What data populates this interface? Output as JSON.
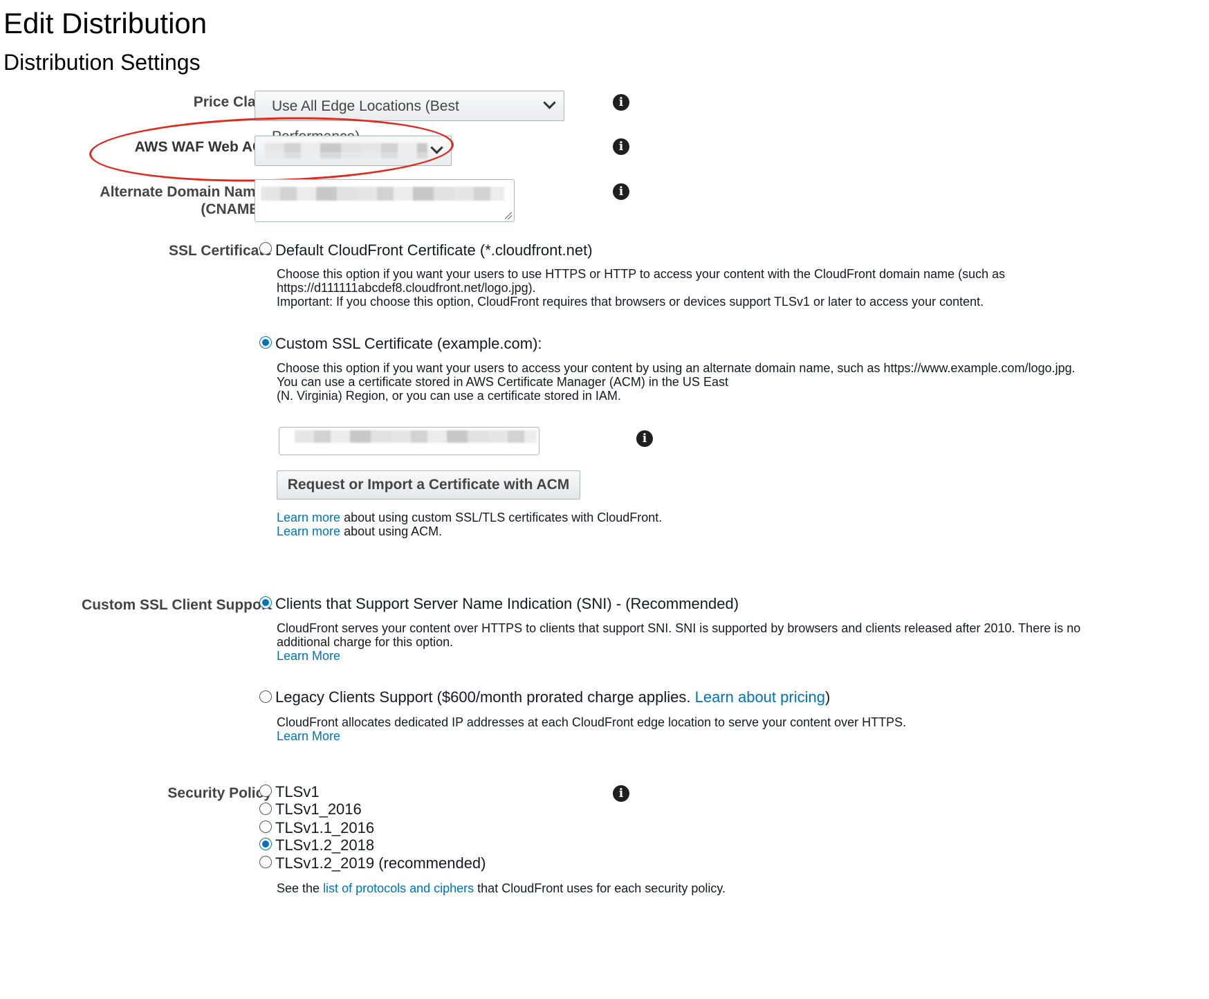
{
  "page": {
    "title": "Edit Distribution",
    "section": "Distribution Settings"
  },
  "price_class": {
    "label": "Price Class",
    "value": "Use All Edge Locations (Best Performance)"
  },
  "waf": {
    "label": "AWS WAF Web ACL"
  },
  "cnames": {
    "label_line1": "Alternate Domain Names",
    "label_line2": "(CNAMEs)"
  },
  "ssl": {
    "label": "SSL Certificate",
    "default_option": "Default CloudFront Certificate (*.cloudfront.net)",
    "default_desc_1": "Choose this option if you want your users to use HTTPS or HTTP to access your content with the CloudFront domain name (such as",
    "default_desc_2": "https://d111111abcdef8.cloudfront.net/logo.jpg).",
    "default_desc_3": "Important: If you choose this option, CloudFront requires that browsers or devices support TLSv1 or later to access your content.",
    "custom_option": "Custom SSL Certificate (example.com):",
    "custom_desc_1": "Choose this option if you want your users to access your content by using an alternate domain name, such as https://www.example.com/logo.jpg.",
    "custom_desc_2": "You can use a certificate stored in AWS Certificate Manager (ACM) in the US East",
    "custom_desc_3": "(N. Virginia) Region, or you can use a certificate stored in IAM.",
    "acm_button": "Request or Import a Certificate with ACM",
    "learn_more_1_link": "Learn more",
    "learn_more_1_text": " about using custom SSL/TLS certificates with CloudFront.",
    "learn_more_2_link": "Learn more",
    "learn_more_2_text": " about using ACM."
  },
  "client_support": {
    "label": "Custom SSL Client Support",
    "sni_option": "Clients that Support Server Name Indication (SNI) - (Recommended)",
    "sni_desc_1": "CloudFront serves your content over HTTPS to clients that support SNI. SNI is supported by browsers and clients released after 2010. There is no",
    "sni_desc_2": "additional charge for this option.",
    "sni_learn_more": "Learn More",
    "legacy_option_a": "Legacy Clients Support ($600/month prorated charge applies. ",
    "legacy_option_link": "Learn about pricing",
    "legacy_option_b": ")",
    "legacy_desc": "CloudFront allocates dedicated IP addresses at each CloudFront edge location to serve your content over HTTPS.",
    "legacy_learn_more": "Learn More"
  },
  "security_policy": {
    "label": "Security Policy",
    "options": [
      "TLSv1",
      "TLSv1_2016",
      "TLSv1.1_2016",
      "TLSv1.2_2018",
      "TLSv1.2_2019 (recommended)"
    ],
    "selected": "TLSv1.2_2018",
    "footer_a": "See the ",
    "footer_link": "list of protocols and ciphers",
    "footer_b": " that CloudFront uses for each security policy."
  },
  "icons": {
    "info": "i",
    "annotation_color": "#e0281d",
    "accent": "#0073bb"
  }
}
